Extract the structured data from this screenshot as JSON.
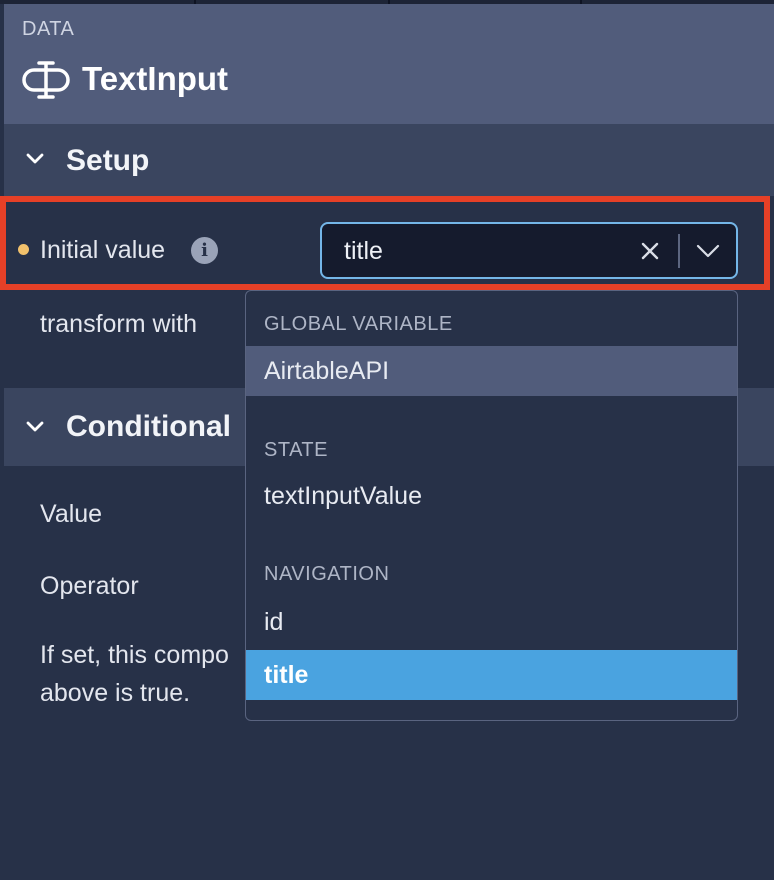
{
  "header": {
    "category": "DATA",
    "component_name": "TextInput",
    "icon": "text-input-icon"
  },
  "setup": {
    "title": "Setup",
    "initial_value": {
      "label": "Initial value",
      "value": "title",
      "required_indicator_color": "#f2c16c",
      "info_icon": "info-icon"
    },
    "transform_label": "transform with"
  },
  "conditional": {
    "title": "Conditional",
    "value_label": "Value",
    "operator_label": "Operator",
    "description_line1": "If set, this compo",
    "description_line2": "above is true."
  },
  "dropdown": {
    "groups": [
      {
        "label": "GLOBAL VARIABLE",
        "options": [
          "AirtableAPI"
        ]
      },
      {
        "label": "STATE",
        "options": [
          "textInputValue"
        ]
      },
      {
        "label": "NAVIGATION",
        "options": [
          "id",
          "title"
        ]
      }
    ],
    "hovered_option": "AirtableAPI",
    "selected_option": "title"
  },
  "colors": {
    "highlight_border": "#e64027",
    "focus_border": "#74b6e8",
    "selected_option_bg": "#4aa3e0"
  }
}
